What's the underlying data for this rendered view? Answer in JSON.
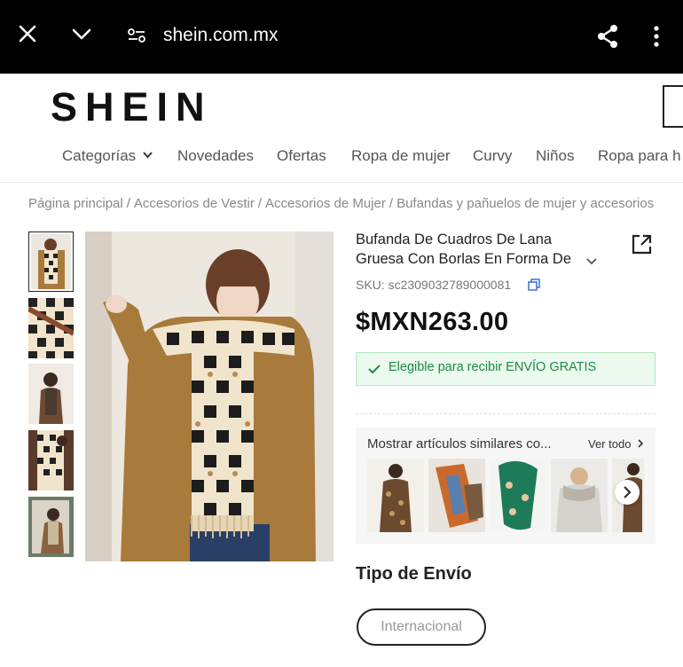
{
  "browser": {
    "url": "shein.com.mx",
    "icons": [
      "close-icon",
      "chevron-down-icon",
      "site-settings-icon",
      "share-icon",
      "more-vertical-icon"
    ]
  },
  "header": {
    "logo": "SHEIN"
  },
  "nav": {
    "items": [
      "Categorías",
      "Novedades",
      "Ofertas",
      "Ropa de mujer",
      "Curvy",
      "Niños",
      "Ropa para h"
    ]
  },
  "breadcrumb": {
    "items": [
      "Página principal",
      "Accesorios de Vestir",
      "Accesorios de Mujer",
      "Bufandas y pañuelos de mujer y accesorios"
    ],
    "separator": "/"
  },
  "product": {
    "title": "Bufanda De Cuadros De Lana Gruesa Con Borlas En Forma De Corazón",
    "sku": "SKU: sc2309032789000081",
    "price": "$MXN263.00",
    "shipping_banner": "Elegible para recibir ENVÍO GRATIS"
  },
  "similar": {
    "title": "Mostrar artículos similares co...",
    "view_all": "Ver todo"
  },
  "shipping_type": {
    "title": "Tipo de Envío",
    "option": "Internacional"
  },
  "colors": {
    "shipping_green": "#198c42",
    "banner_bg": "#ecf9ef",
    "coat_brown": "#a87a3c"
  }
}
